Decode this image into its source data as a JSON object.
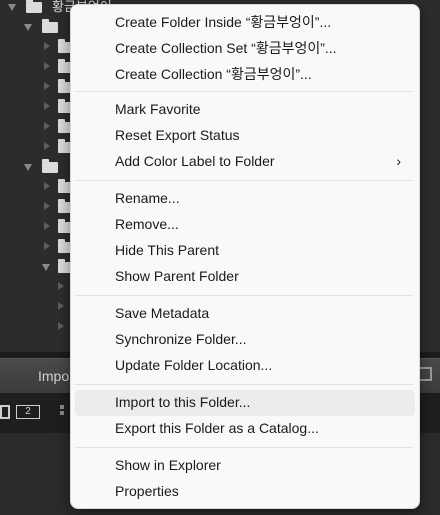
{
  "background_app": {
    "top_folder_label": "황금부엉이",
    "import_button_label": "Impo",
    "filmstrip_page_number": "2"
  },
  "context_menu": {
    "group1": [
      {
        "label": "Create Folder Inside “황금부엉이”..."
      },
      {
        "label": "Create Collection Set “황금부엉이”..."
      },
      {
        "label": "Create Collection “황금부엉이”..."
      }
    ],
    "group2": [
      {
        "label": "Mark Favorite"
      },
      {
        "label": "Reset Export Status"
      },
      {
        "label": "Add Color Label to Folder",
        "submenu_arrow": "›"
      }
    ],
    "group3": [
      {
        "label": "Rename..."
      },
      {
        "label": "Remove..."
      },
      {
        "label": "Hide This Parent"
      },
      {
        "label": "Show Parent Folder"
      }
    ],
    "group4": [
      {
        "label": "Save Metadata"
      },
      {
        "label": "Synchronize Folder..."
      },
      {
        "label": "Update Folder Location..."
      }
    ],
    "group5": [
      {
        "label": "Import to this Folder...",
        "hovered": true
      },
      {
        "label": "Export this Folder as a Catalog..."
      }
    ],
    "group6": [
      {
        "label": "Show in Explorer"
      },
      {
        "label": "Properties"
      }
    ]
  },
  "colors": {
    "menu_background": "#f9f9f9",
    "menu_hover": "#ececec",
    "menu_text": "#1a1a1a",
    "panel_background": "#2c2c2c"
  }
}
